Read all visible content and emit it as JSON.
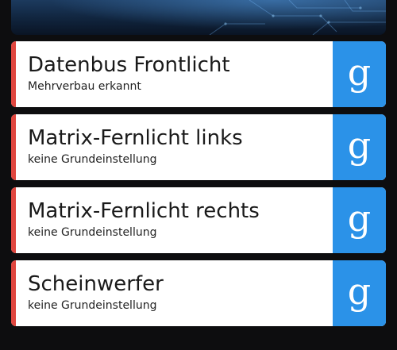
{
  "items": [
    {
      "title": "Datenbus Frontlicht",
      "subtitle": "Mehrverbau erkannt",
      "action_icon": "g-glyph-icon",
      "action_glyph": "g"
    },
    {
      "title": "Matrix-Fernlicht links",
      "subtitle": "keine Grundeinstellung",
      "action_icon": "g-glyph-icon",
      "action_glyph": "g"
    },
    {
      "title": "Matrix-Fernlicht rechts",
      "subtitle": "keine Grundeinstellung",
      "action_icon": "g-glyph-icon",
      "action_glyph": "g"
    },
    {
      "title": "Scheinwerfer",
      "subtitle": "keine Grundeinstellung",
      "action_icon": "g-glyph-icon",
      "action_glyph": "g"
    }
  ],
  "colors": {
    "background": "#0d0d0f",
    "card": "#ffffff",
    "accent": "#e0463f",
    "action": "#2b92e8"
  }
}
